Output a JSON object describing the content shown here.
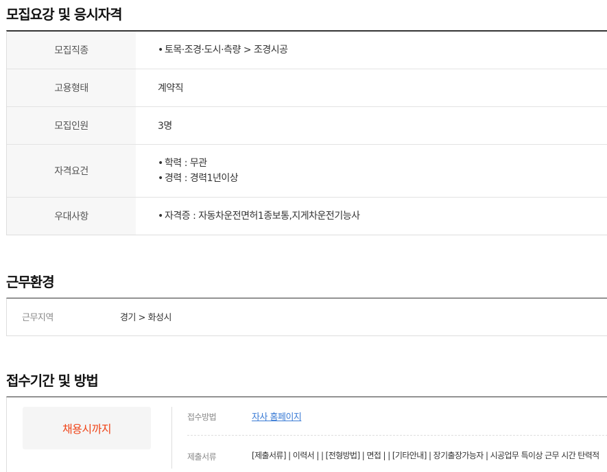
{
  "requirements": {
    "title": "모집요강 및 응시자격",
    "rows": [
      {
        "label": "모집직종",
        "items": [
          "토목·조경·도시·측량 > 조경시공"
        ]
      },
      {
        "label": "고용형태",
        "value": "계약직"
      },
      {
        "label": "모집인원",
        "value": "3명"
      },
      {
        "label": "자격요건",
        "items": [
          "학력 : 무관",
          "경력 : 경력1년이상"
        ]
      },
      {
        "label": "우대사항",
        "items": [
          "자격증 : 자동차운전면허1종보통,지게차운전기능사"
        ]
      }
    ]
  },
  "environment": {
    "title": "근무환경",
    "location_label": "근무지역",
    "location_value": "경기 > 화성시"
  },
  "application": {
    "title": "접수기간 및 방법",
    "deadline": "채용시까지",
    "method_label": "접수방법",
    "method_link": "자사 홈페이지",
    "docs_label": "제출서류",
    "docs_text": "[제출서류] | 이력서 | | [전형방법] | 면접 | | [기타안내] | 장기출장가능자 | 시공업무 특이상 근무 시간 탄력적"
  }
}
